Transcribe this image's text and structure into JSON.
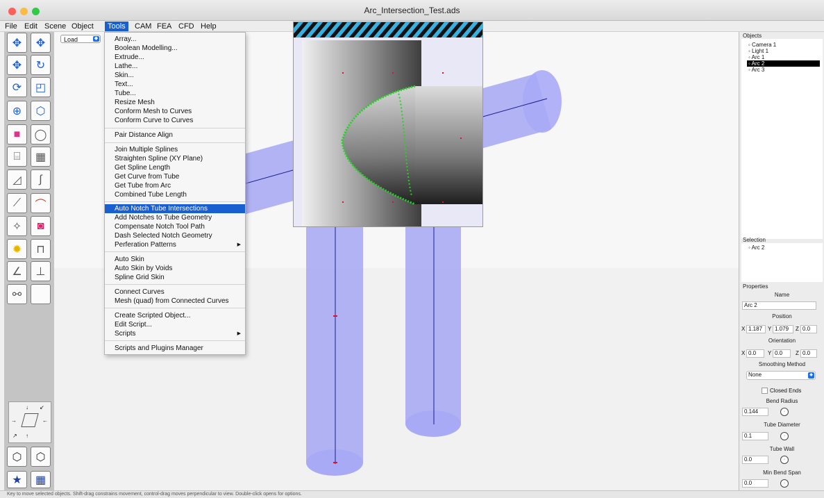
{
  "window": {
    "title": "Arc_Intersection_Test.ads",
    "colors": {
      "close": "#fc605b",
      "minimize": "#fdbc40",
      "zoom": "#34c84a"
    }
  },
  "menubar": [
    {
      "label": "File"
    },
    {
      "label": "Edit"
    },
    {
      "label": "Scene"
    },
    {
      "label": "Object"
    },
    {
      "label": "Tools",
      "active": true
    },
    {
      "label": "CAM"
    },
    {
      "label": "FEA"
    },
    {
      "label": "CFD"
    },
    {
      "label": "Help"
    }
  ],
  "tools_menu": {
    "items": [
      "Array...",
      "Boolean Modelling...",
      "Extrude...",
      "Lathe...",
      "Skin...",
      "Text...",
      "Tube...",
      "Resize Mesh",
      "Conform Mesh to Curves",
      "Conform Curve to Curves",
      "Pair Distance Align",
      "Join Multiple Splines",
      "Straighten Spline (XY Plane)",
      "Get Spline Length",
      "Get Curve from Tube",
      "Get Tube from Arc",
      "Combined Tube Length",
      "Auto Notch Tube Intersections",
      "Add Notches to Tube Geometry",
      "Compensate Notch Tool Path",
      "Dash Selected Notch Geometry",
      "Perferation Patterns",
      "Auto Skin",
      "Auto Skin by Voids",
      "Spline Grid Skin",
      "Connect Curves",
      "Mesh (quad) from Connected Curves",
      "Create Scripted Object...",
      "Edit Script...",
      "Scripts",
      "Scripts and Plugins Manager"
    ],
    "highlighted": "Auto Notch Tube Intersections",
    "submenu_items": [
      "Perferation Patterns",
      "Scripts"
    ]
  },
  "viewport": {
    "view_selector": "Load"
  },
  "objects_panel": {
    "title": "Objects",
    "items": [
      "Camera 1",
      "Light 1",
      "Arc 1",
      "Arc 2",
      "Arc 3"
    ],
    "selected": "Arc 2"
  },
  "selection_panel": {
    "title": "Selection",
    "items": [
      "Arc 2"
    ]
  },
  "properties": {
    "title": "Properties",
    "name_label": "Name",
    "name_value": "Arc 2",
    "position_label": "Position",
    "position": {
      "x": "1.187",
      "y": "1.079",
      "z": "0.0"
    },
    "orientation_label": "Orientation",
    "orientation": {
      "x": "0.0",
      "y": "0.0",
      "z": "0.0"
    },
    "smoothing_label": "Smoothing Method",
    "smoothing_value": "None",
    "closed_ends_label": "Closed Ends",
    "bend_radius_label": "Bend Radius",
    "bend_radius": "0.144",
    "tube_diameter_label": "Tube Diameter",
    "tube_diameter": "0.1",
    "tube_wall_label": "Tube Wall",
    "tube_wall": "0.0",
    "min_bend_span_label": "Min Bend Span",
    "min_bend_span": "0.0",
    "axis_labels": {
      "x": "X",
      "y": "Y",
      "z": "Z"
    }
  },
  "status_text": "Key to move selected objects. Shift-drag constrains movement, control-drag moves perpendicular to view. Double-click opens for options.",
  "colors": {
    "accent": "#1a5fd0",
    "tube_fill": "#9a9cf4",
    "notch_points": "#22d422"
  }
}
